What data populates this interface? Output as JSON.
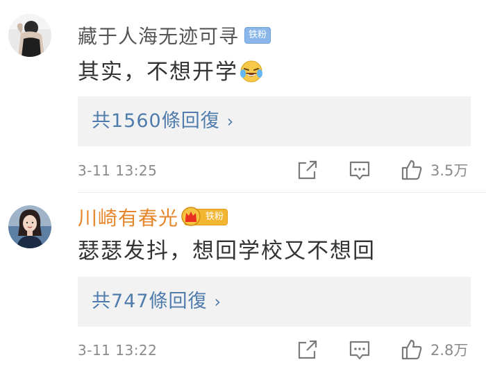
{
  "comments": [
    {
      "username": "藏于人海无迹可寻",
      "badge": "铁粉",
      "text": "其实，不想开学",
      "emoji_icon": "laughing-crying-emoji-icon",
      "replies_label": "共1560條回復",
      "replies_chevron": "›",
      "time": "3-11 13:25",
      "likes": "3.5万"
    },
    {
      "username": "川崎有春光",
      "badge": "铁粉",
      "text": "瑟瑟发抖，想回学校又不想回",
      "replies_label": "共747條回復",
      "replies_chevron": "›",
      "time": "3-11 13:22",
      "likes": "2.8万"
    }
  ],
  "colors": {
    "username_default": "#555555",
    "username_vip": "#e6862a",
    "reply_link": "#4f7cad",
    "reply_bg": "#f2f2f2",
    "badge_blue": "#8ab6ea",
    "badge_gold": "#f2b632"
  }
}
